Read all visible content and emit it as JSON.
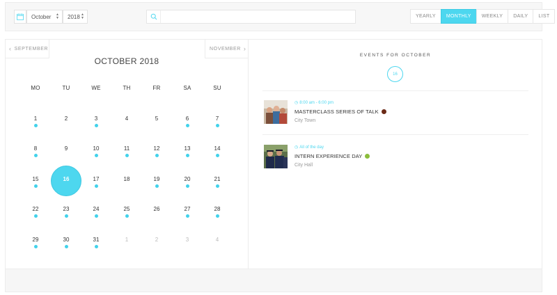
{
  "toolbar": {
    "month_value": "October",
    "year_value": "2018",
    "search_placeholder": "",
    "views": [
      {
        "label": "YEARLY",
        "active": false
      },
      {
        "label": "MONTHLY",
        "active": true
      },
      {
        "label": "WEEKLY",
        "active": false
      },
      {
        "label": "DAILY",
        "active": false
      },
      {
        "label": "LIST",
        "active": false
      }
    ]
  },
  "calendar": {
    "prev_label": "SEPTEMBER",
    "next_label": "NOVEMBER",
    "title": "OCTOBER 2018",
    "weekdays": [
      "MO",
      "TU",
      "WE",
      "TH",
      "FR",
      "SA",
      "SU"
    ],
    "weeks": [
      [
        {
          "d": "1",
          "ev": true
        },
        {
          "d": "2",
          "ev": false
        },
        {
          "d": "3",
          "ev": true
        },
        {
          "d": "4",
          "ev": false
        },
        {
          "d": "5",
          "ev": false
        },
        {
          "d": "6",
          "ev": true
        },
        {
          "d": "7",
          "ev": true
        }
      ],
      [
        {
          "d": "8",
          "ev": true
        },
        {
          "d": "9",
          "ev": false
        },
        {
          "d": "10",
          "ev": true
        },
        {
          "d": "11",
          "ev": true
        },
        {
          "d": "12",
          "ev": true
        },
        {
          "d": "13",
          "ev": true
        },
        {
          "d": "14",
          "ev": true
        }
      ],
      [
        {
          "d": "15",
          "ev": true
        },
        {
          "d": "16",
          "ev": false,
          "today": true
        },
        {
          "d": "17",
          "ev": true
        },
        {
          "d": "18",
          "ev": false
        },
        {
          "d": "19",
          "ev": true
        },
        {
          "d": "20",
          "ev": true
        },
        {
          "d": "21",
          "ev": true
        }
      ],
      [
        {
          "d": "22",
          "ev": true
        },
        {
          "d": "23",
          "ev": true
        },
        {
          "d": "24",
          "ev": true
        },
        {
          "d": "25",
          "ev": true
        },
        {
          "d": "26",
          "ev": false
        },
        {
          "d": "27",
          "ev": true
        },
        {
          "d": "28",
          "ev": true
        }
      ],
      [
        {
          "d": "29",
          "ev": true
        },
        {
          "d": "30",
          "ev": true
        },
        {
          "d": "31",
          "ev": true
        },
        {
          "d": "1",
          "ev": false,
          "other": true
        },
        {
          "d": "2",
          "ev": false,
          "other": true
        },
        {
          "d": "3",
          "ev": false,
          "other": true
        },
        {
          "d": "4",
          "ev": false,
          "other": true
        }
      ]
    ]
  },
  "events_panel": {
    "heading": "EVENTS FOR OCTOBER",
    "selected_day": "16",
    "events": [
      {
        "time": "8:00 am - 6:00 pm",
        "title": "MASTERCLASS SERIES OF TALK",
        "color": "#6b2a17",
        "location": "City Town",
        "thumb_icon": "group-photo-icon"
      },
      {
        "time": "All of the day",
        "title": "INTERN EXPERIENCE DAY",
        "color": "#8bbd3c",
        "location": "City Hall",
        "thumb_icon": "graduates-photo-icon"
      }
    ]
  },
  "colors": {
    "accent": "#4dd7ef",
    "dot": "#42d2eb"
  }
}
